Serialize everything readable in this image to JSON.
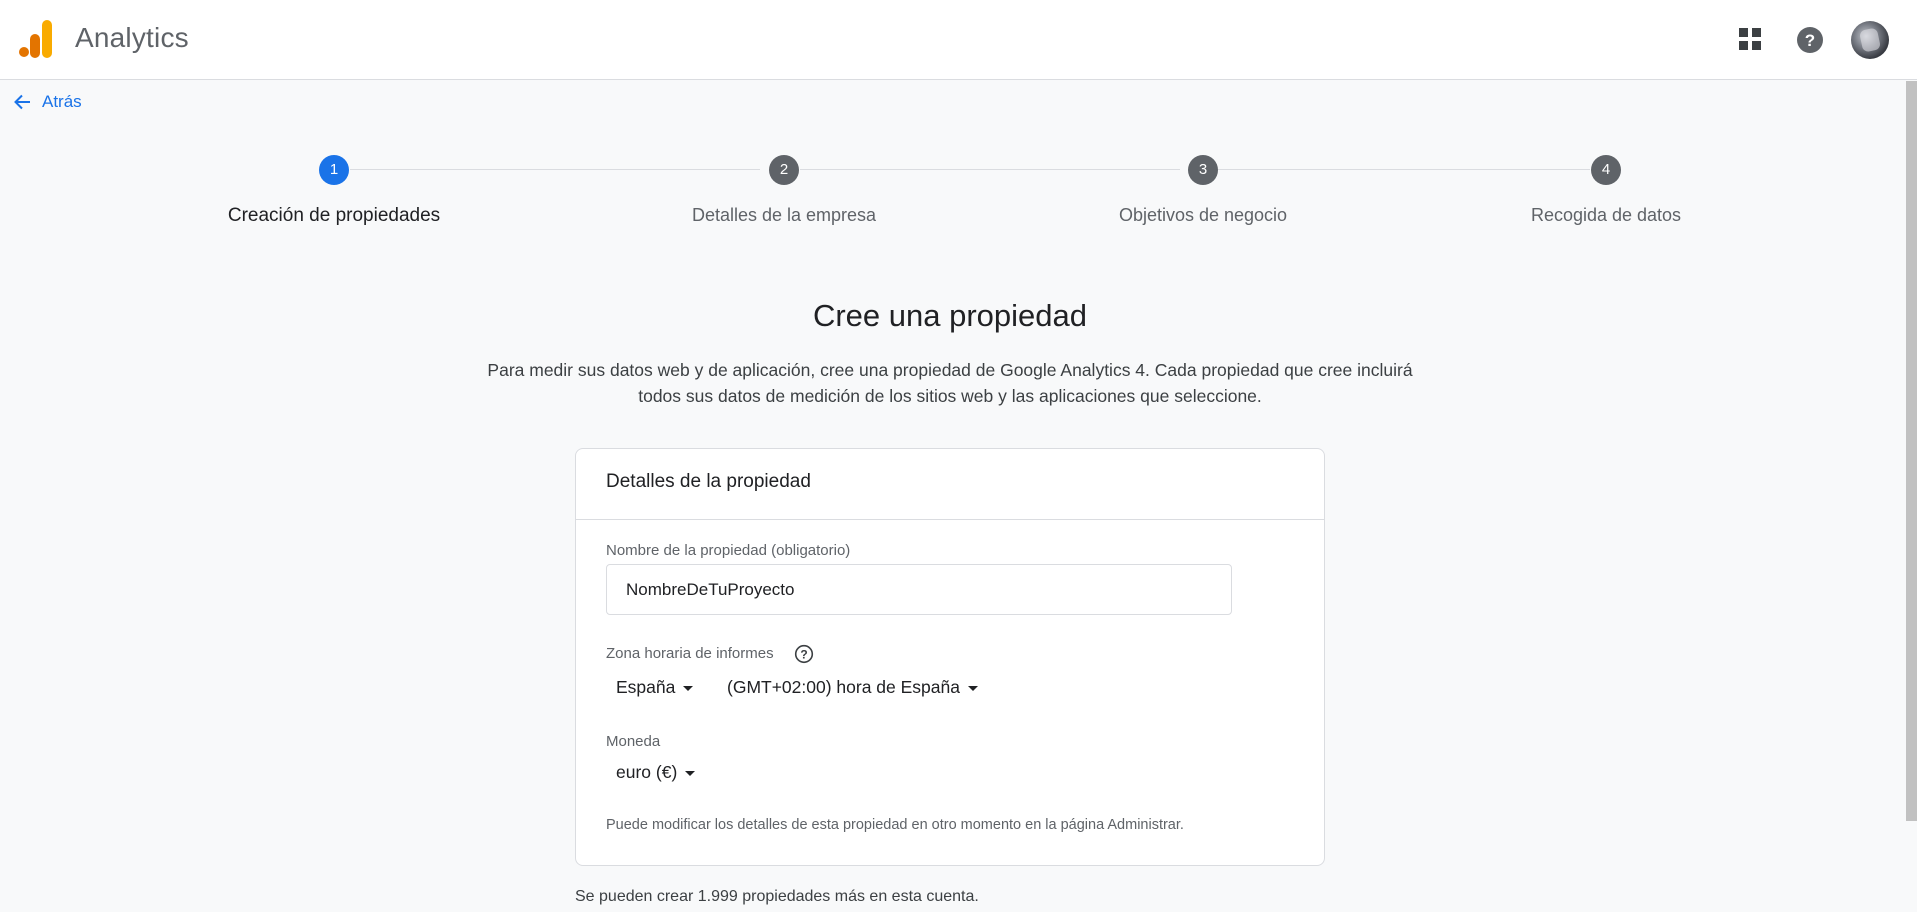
{
  "header": {
    "app_title": "Analytics",
    "logo_colors": [
      "#f9ab00",
      "#e37400"
    ]
  },
  "nav": {
    "back_label": "Atrás"
  },
  "stepper": {
    "active_color": "#1a73e8",
    "inactive_color": "#5f6368",
    "steps": [
      {
        "number": "1",
        "label": "Creación de propiedades",
        "active": true
      },
      {
        "number": "2",
        "label": "Detalles de la empresa",
        "active": false
      },
      {
        "number": "3",
        "label": "Objetivos de negocio",
        "active": false
      },
      {
        "number": "4",
        "label": "Recogida de datos",
        "active": false
      }
    ]
  },
  "main": {
    "headline": "Cree una propiedad",
    "intro_line1": "Para medir sus datos web y de aplicación, cree una propiedad de Google Analytics 4. Cada propiedad que cree incluirá",
    "intro_line2": "todos sus datos de medición de los sitios web y las aplicaciones que seleccione."
  },
  "card": {
    "title": "Detalles de la propiedad",
    "property_name_label": "Nombre de la propiedad (obligatorio)",
    "property_name_value": "NombreDeTuProyecto",
    "timezone_label": "Zona horaria de informes",
    "country_value": "España",
    "timezone_value": "(GMT+02:00) hora de España",
    "currency_label": "Moneda",
    "currency_value": "euro (€)",
    "note": "Puede modificar los detalles de esta propiedad en otro momento en la página Administrar."
  },
  "footer_note": "Se pueden crear 1.999 propiedades más en esta cuenta.",
  "icons": {
    "back": "arrow-back-icon",
    "apps": "apps-grid-icon",
    "help": "help-circle-icon",
    "tooltip": "help-outline-icon"
  }
}
